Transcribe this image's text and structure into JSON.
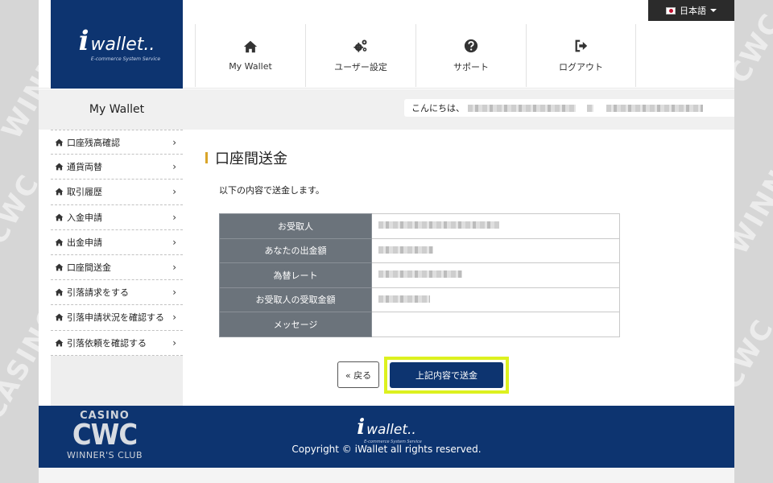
{
  "language": {
    "label": "日本語"
  },
  "logo": {
    "i": "i",
    "text": "wallet..",
    "sub": "E-commerce System Service"
  },
  "nav": [
    {
      "label": "My Wallet",
      "icon": "home-icon"
    },
    {
      "label": "ユーザー設定",
      "icon": "gears-icon"
    },
    {
      "label": "サポート",
      "icon": "question-icon"
    },
    {
      "label": "ログアウト",
      "icon": "logout-icon"
    }
  ],
  "subbar": {
    "title": "My Wallet",
    "greeting": "こんにちは、"
  },
  "sidebar": {
    "items": [
      {
        "label": "口座残高確認"
      },
      {
        "label": "通貨両替"
      },
      {
        "label": "取引履歴"
      },
      {
        "label": "入金申請"
      },
      {
        "label": "出金申請"
      },
      {
        "label": "口座間送金"
      },
      {
        "label": "引落請求をする"
      },
      {
        "label": "引落申請状況を確認する"
      },
      {
        "label": "引落依頼を確認する"
      }
    ]
  },
  "main": {
    "title": "口座間送金",
    "intro": "以下の内容で送金します。",
    "rows": [
      {
        "label": "お受取人"
      },
      {
        "label": "あなたの出金額"
      },
      {
        "label": "為替レート"
      },
      {
        "label": "お受取人の受取金額"
      },
      {
        "label": "メッセージ"
      }
    ],
    "back_label": "« 戻る",
    "submit_label": "上記内容で送金"
  },
  "footer": {
    "copyright": "Copyright © iWallet all rights reserved."
  },
  "watermark": {
    "top": "CASINO",
    "mid": "CWC",
    "bottom": "WINNER'S CLUB"
  },
  "colors": {
    "brand_navy": "#0d3470",
    "highlight": "#ddf11f",
    "title_accent": "#d9a52a",
    "table_header": "#6b737b"
  }
}
